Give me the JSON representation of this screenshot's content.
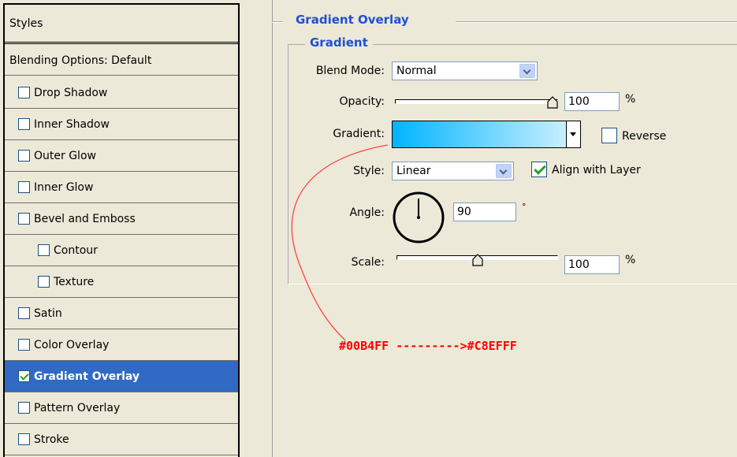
{
  "sidebar": {
    "header": "Styles",
    "blending": "Blending Options: Default",
    "items": [
      {
        "label": "Drop Shadow",
        "checked": false,
        "indent": false,
        "selected": false
      },
      {
        "label": "Inner Shadow",
        "checked": false,
        "indent": false,
        "selected": false
      },
      {
        "label": "Outer Glow",
        "checked": false,
        "indent": false,
        "selected": false
      },
      {
        "label": "Inner Glow",
        "checked": false,
        "indent": false,
        "selected": false
      },
      {
        "label": "Bevel and Emboss",
        "checked": false,
        "indent": false,
        "selected": false
      },
      {
        "label": "Contour",
        "checked": false,
        "indent": true,
        "selected": false
      },
      {
        "label": "Texture",
        "checked": false,
        "indent": true,
        "selected": false
      },
      {
        "label": "Satin",
        "checked": false,
        "indent": false,
        "selected": false
      },
      {
        "label": "Color Overlay",
        "checked": false,
        "indent": false,
        "selected": false
      },
      {
        "label": "Gradient Overlay",
        "checked": true,
        "indent": false,
        "selected": true
      },
      {
        "label": "Pattern Overlay",
        "checked": false,
        "indent": false,
        "selected": false
      },
      {
        "label": "Stroke",
        "checked": false,
        "indent": false,
        "selected": false
      }
    ]
  },
  "panel": {
    "title": "Gradient Overlay",
    "group_title": "Gradient",
    "blend_mode": {
      "label": "Blend Mode:",
      "value": "Normal"
    },
    "opacity": {
      "label": "Opacity:",
      "value": "100",
      "unit": "%",
      "level": 1.0
    },
    "gradient": {
      "label": "Gradient:",
      "from_color": "#00B4FF",
      "to_color": "#C8EFFF"
    },
    "reverse": {
      "label": "Reverse",
      "checked": false
    },
    "style": {
      "label": "Style:",
      "value": "Linear"
    },
    "align": {
      "label": "Align with Layer",
      "checked": true
    },
    "angle": {
      "label": "Angle:",
      "value": "90",
      "unit": "°"
    },
    "scale": {
      "label": "Scale:",
      "value": "100",
      "unit": "%",
      "level": 0.5
    }
  },
  "annotation": {
    "text": "#00B4FF --------->#C8EFFF",
    "color": "#ff0000"
  },
  "colors": {
    "selection": "#316AC5",
    "legend": "#1f4fd6",
    "background": "#ECE9D8"
  }
}
